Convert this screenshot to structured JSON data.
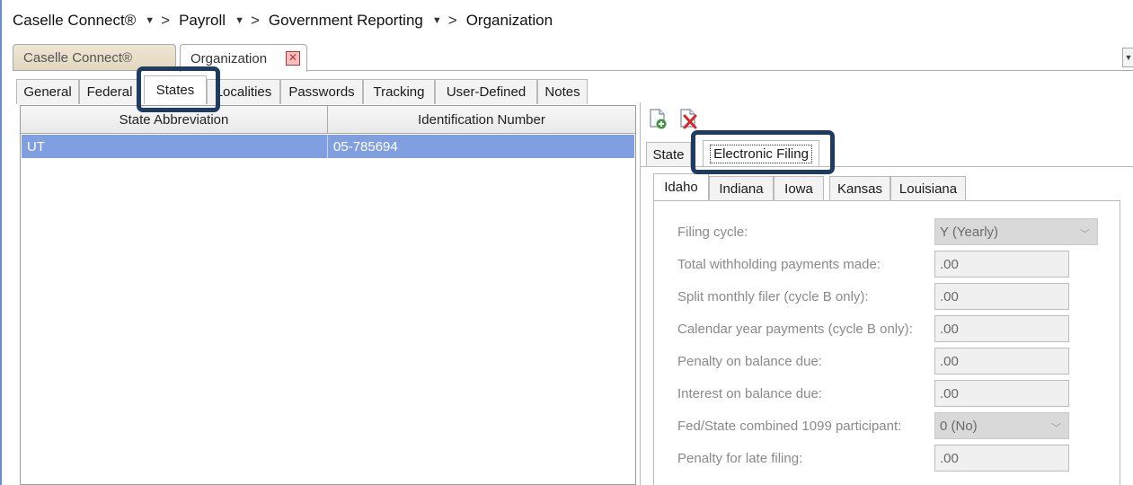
{
  "breadcrumb": {
    "items": [
      "Caselle Connect®",
      "Payroll",
      "Government Reporting",
      "Organization"
    ],
    "separator": ">",
    "caret_icon": "chevron-down-icon"
  },
  "document_tabs": {
    "inactive_label": "Caselle Connect®",
    "active_label": "Organization",
    "close_icon": "close-icon",
    "menu_icon": "chevron-down-icon"
  },
  "section_tabs": [
    "General",
    "Federal",
    "States",
    "Localities",
    "Passwords",
    "Tracking",
    "User-Defined",
    "Notes"
  ],
  "section_tabs_active": "States",
  "grid": {
    "columns": [
      "State Abbreviation",
      "Identification Number"
    ],
    "rows": [
      {
        "state": "UT",
        "id": "05-785694"
      }
    ]
  },
  "toolbar": {
    "add_icon": "add-document-icon",
    "delete_icon": "delete-document-icon"
  },
  "detail_tabs": [
    "State",
    "Electronic Filing"
  ],
  "detail_tabs_active": "Electronic Filing",
  "state_tabs": [
    "Idaho",
    "Indiana",
    "Iowa",
    "Kansas",
    "Louisiana"
  ],
  "state_tabs_active": "Idaho",
  "fields": [
    {
      "label": "Filing cycle:",
      "value": "Y (Yearly)",
      "type": "select"
    },
    {
      "label": "Total withholding payments made:",
      "value": ".00",
      "type": "input"
    },
    {
      "label": "Split monthly filer (cycle B only):",
      "value": ".00",
      "type": "input"
    },
    {
      "label": "Calendar year payments (cycle B only):",
      "value": ".00",
      "type": "input"
    },
    {
      "label": "Penalty on balance due:",
      "value": ".00",
      "type": "input"
    },
    {
      "label": "Interest on balance due:",
      "value": ".00",
      "type": "input"
    },
    {
      "label": "Fed/State combined 1099 participant:",
      "value": "0 (No)",
      "type": "select"
    },
    {
      "label": "Penalty for late filing:",
      "value": ".00",
      "type": "input"
    }
  ],
  "colors": {
    "selected_row": "#7f9fe1",
    "highlight_border": "#1f3b62",
    "inactive_doc_tab": "#e8dec8"
  }
}
